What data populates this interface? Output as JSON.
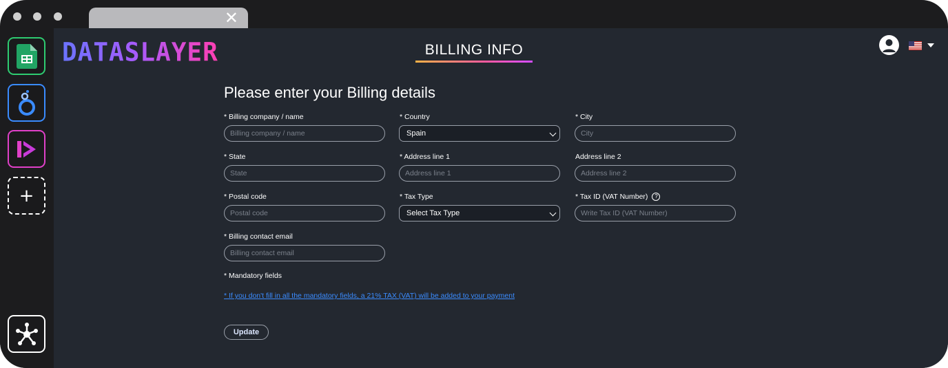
{
  "window": {
    "tab_close_glyph": "✕"
  },
  "sidebar": {
    "items": [
      {
        "name": "google-sheets",
        "icon": "google-sheets-icon",
        "color": "#2ecc71"
      },
      {
        "name": "looker-studio",
        "icon": "looker-studio-icon",
        "color": "#3a8bff"
      },
      {
        "name": "power-bi",
        "icon": "power-bi-icon",
        "color": "#e040c8"
      },
      {
        "name": "add",
        "icon": "plus-icon",
        "glyph": "+",
        "color": "#ffffff"
      }
    ],
    "bottom_item": {
      "name": "connectors",
      "icon": "network-icon",
      "color": "#ffffff"
    }
  },
  "header": {
    "logo_text": "DATASLAYER",
    "title": "BILLING INFO",
    "language_flag": "us-flag-icon"
  },
  "form": {
    "heading": "Please enter your Billing details",
    "fields": {
      "billing_company": {
        "label": "* Billing company / name",
        "placeholder": "Billing company / name",
        "value": ""
      },
      "country": {
        "label": "* Country",
        "value": "Spain"
      },
      "city": {
        "label": "* City",
        "placeholder": "City",
        "value": ""
      },
      "state": {
        "label": "* State",
        "placeholder": "State",
        "value": ""
      },
      "address1": {
        "label": "* Address line 1",
        "placeholder": "Address line 1",
        "value": ""
      },
      "address2": {
        "label": "Address line 2",
        "placeholder": "Address line 2",
        "value": ""
      },
      "postal_code": {
        "label": "* Postal code",
        "placeholder": "Postal code",
        "value": ""
      },
      "tax_type": {
        "label": "* Tax Type",
        "value": "Select Tax Type"
      },
      "tax_id": {
        "label": "* Tax ID (VAT Number)",
        "placeholder": "Write Tax ID (VAT Number)",
        "value": "",
        "help_glyph": "?"
      },
      "billing_email": {
        "label": "* Billing contact email",
        "placeholder": "Billing contact email",
        "value": ""
      }
    },
    "mandatory_note": "* Mandatory fields",
    "tax_warning_link": "* If you don't fill in all the mandatory fields, a 21% TAX (VAT) will be added to your payment",
    "update_label": "Update"
  },
  "colors": {
    "background": "#232830",
    "sidebar": "#1c1c1e",
    "link": "#3b8cff",
    "accent_gradient_start": "#ffb347",
    "accent_gradient_end": "#d24dff"
  }
}
